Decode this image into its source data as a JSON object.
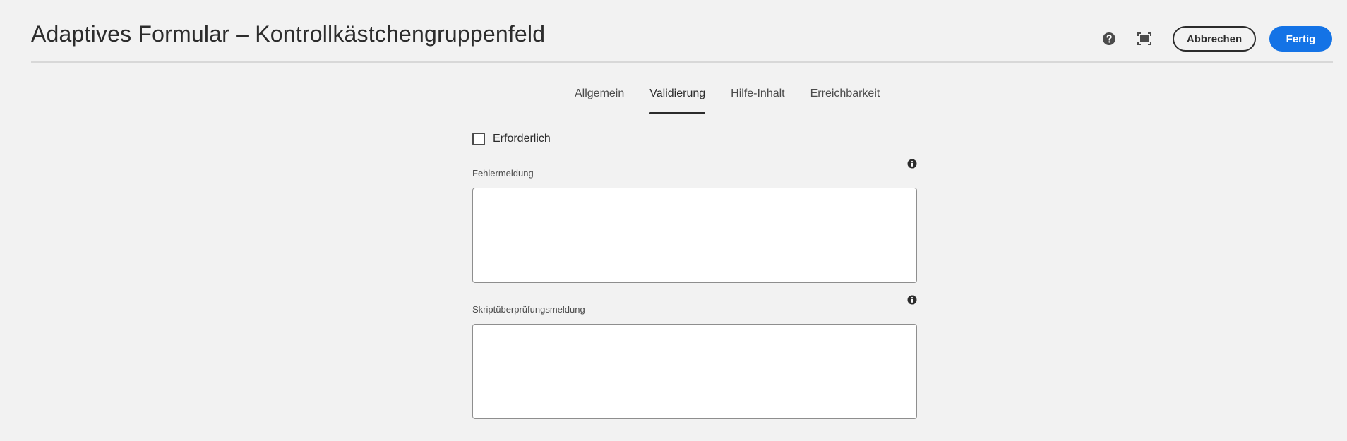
{
  "header": {
    "title": "Adaptives Formular – Kontrollkästchengruppenfeld",
    "help_icon": "help-circle-icon",
    "fullscreen_icon": "fullscreen-icon",
    "cancel_label": "Abbrechen",
    "done_label": "Fertig"
  },
  "tabs": [
    {
      "label": "Allgemein",
      "active": false
    },
    {
      "label": "Validierung",
      "active": true
    },
    {
      "label": "Hilfe-Inhalt",
      "active": false
    },
    {
      "label": "Erreichbarkeit",
      "active": false
    }
  ],
  "form": {
    "required": {
      "label": "Erforderlich",
      "checked": false
    },
    "error_message": {
      "label": "Fehlermeldung",
      "value": "",
      "info_icon": "info-icon"
    },
    "script_validation_message": {
      "label": "Skriptüberprüfungsmeldung",
      "value": "",
      "info_icon": "info-icon"
    }
  },
  "colors": {
    "background": "#f2f2f2",
    "primary": "#1473e6",
    "text": "#2c2c2c"
  }
}
